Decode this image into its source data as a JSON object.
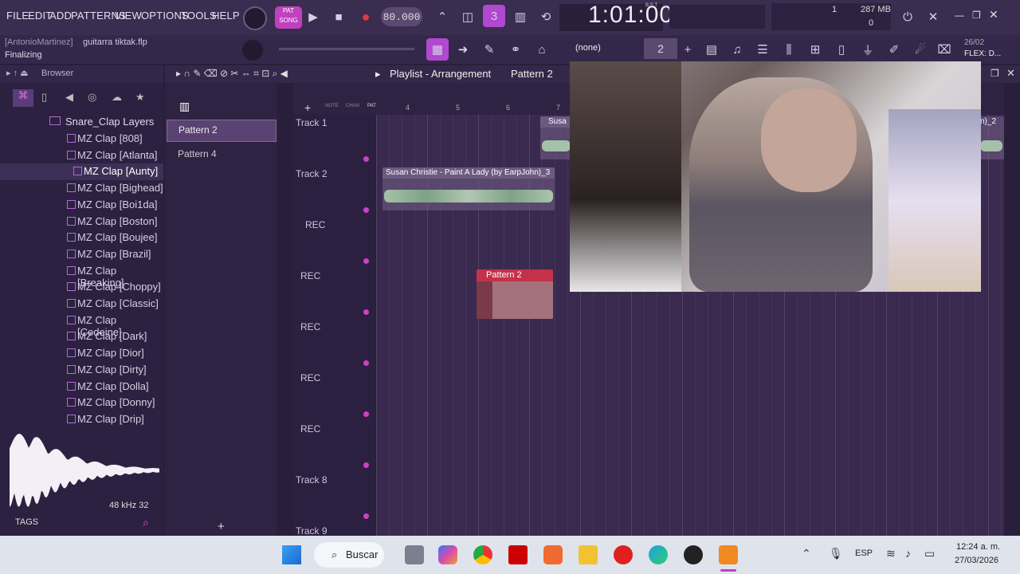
{
  "menu": [
    "FILE",
    "EDIT",
    "ADD",
    "PATTERNS",
    "VIEW",
    "OPTIONS",
    "TOOLS",
    "HELP"
  ],
  "transport": {
    "mode": "SONG",
    "pat": "PAT",
    "tempo": "80.000",
    "time": "1:01:00",
    "bst": "B:S:T"
  },
  "status": {
    "user": "[AntonioMartinez]",
    "file": "guitarra tiktak.flp",
    "action": "Finalizing"
  },
  "perf": {
    "cpu": "1",
    "ram": "287 MB",
    "poly": "0"
  },
  "snap": {
    "value": "(none)",
    "pattern_num": "2"
  },
  "news": {
    "date": "26/02",
    "label": "FLEX: D..."
  },
  "browser": {
    "title": "Browser",
    "folder": "Snare_Clap Layers",
    "items": [
      "MZ Clap [808]",
      "MZ Clap [Atlanta]",
      "MZ Clap [Aunty]",
      "MZ Clap [Bighead]",
      "MZ Clap [Boi1da]",
      "MZ Clap [Boston]",
      "MZ Clap [Boujee]",
      "MZ Clap [Brazil]",
      "MZ Clap [Breaking]",
      "MZ Clap [Choppy]",
      "MZ Clap [Classic]",
      "MZ Clap [Codeine]",
      "MZ Clap [Dark]",
      "MZ Clap [Dior]",
      "MZ Clap [Dirty]",
      "MZ Clap [Dolla]",
      "MZ Clap [Donny]",
      "MZ Clap [Drip]"
    ],
    "selected_index": 2,
    "sample_info": "48 kHz 32",
    "tags": "TAGS"
  },
  "playlist": {
    "title": "Playlist - Arrangement",
    "current_pattern": "Pattern 2",
    "patterns": [
      "Pattern 2",
      "Pattern 4"
    ],
    "ruler": [
      "4",
      "5",
      "6",
      "7"
    ],
    "toolbar_labels": {
      "note": "NOTE",
      "chan": "CHAN",
      "pat": "PAT"
    },
    "tracks": [
      "Track 1",
      "Track 2",
      "REC",
      "REC",
      "REC",
      "REC",
      "REC",
      "Track 8",
      "Track 9"
    ],
    "clips": [
      {
        "label": "Susan Christie - Paint A Lady (by EarpJohn)_3"
      },
      {
        "label": "Susa"
      },
      {
        "label": "Pattern 2"
      },
      {
        "label": "n)_2"
      }
    ]
  },
  "taskbar": {
    "search": "Buscar",
    "lang": "ESP",
    "time": "12:24 a. m.",
    "date": "27/03/2026"
  }
}
